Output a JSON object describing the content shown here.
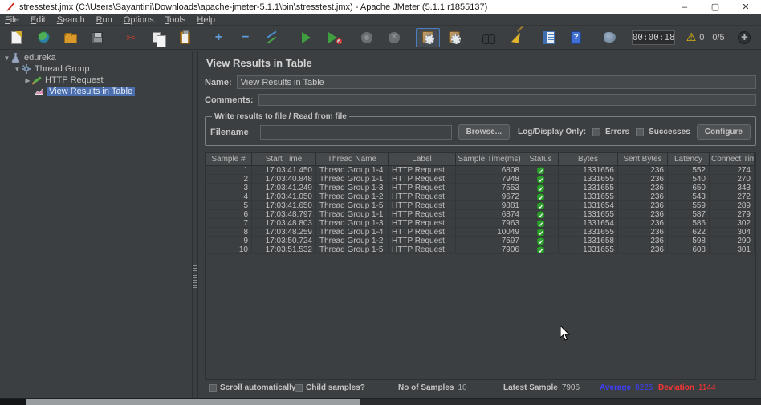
{
  "colors": {
    "selection": "#4b6eaf",
    "average": "#3f3fff",
    "deviation": "#ff3434",
    "status_ok": "#2f9e2f"
  },
  "window": {
    "title": "stresstest.jmx (C:\\Users\\Sayantini\\Downloads\\apache-jmeter-5.1.1\\bin\\stresstest.jmx) - Apache JMeter (5.1.1 r1855137)",
    "minimize": "–",
    "maximize": "▢",
    "close": "✕"
  },
  "menu": {
    "items": [
      "File",
      "Edit",
      "Search",
      "Run",
      "Options",
      "Tools",
      "Help"
    ]
  },
  "toolbar": {
    "timer": "00:00:18",
    "warning_count": "0",
    "thread_counter": "0/5",
    "help_glyph": "?",
    "plus": "+",
    "minus": "−",
    "cut_glyph": "✂",
    "x_glyph": "✕"
  },
  "tree": {
    "items": [
      {
        "label": "edureka",
        "expanded": true
      },
      {
        "label": "Thread Group",
        "expanded": true
      },
      {
        "label": "HTTP Request",
        "expanded": false
      },
      {
        "label": "View Results in Table",
        "selected": true
      }
    ]
  },
  "main": {
    "title": "View Results in Table",
    "name_label": "Name:",
    "name_value": "View Results in Table",
    "comments_label": "Comments:",
    "comments_value": "",
    "file_group": {
      "title": "Write results to file / Read from file",
      "filename_label": "Filename",
      "filename_value": "",
      "browse_label": "Browse...",
      "log_display_label": "Log/Display Only:",
      "errors_label": "Errors",
      "successes_label": "Successes",
      "configure_label": "Configure"
    }
  },
  "table": {
    "columns": [
      "Sample #",
      "Start Time",
      "Thread Name",
      "Label",
      "Sample Time(ms)",
      "Status",
      "Bytes",
      "Sent Bytes",
      "Latency",
      "Connect Time(..."
    ],
    "rows": [
      [
        "1",
        "17:03:41.450",
        "Thread Group 1-4",
        "HTTP Request",
        "6808",
        "success",
        "1331656",
        "236",
        "552",
        "274"
      ],
      [
        "2",
        "17:03:40.848",
        "Thread Group 1-1",
        "HTTP Request",
        "7948",
        "success",
        "1331655",
        "236",
        "540",
        "270"
      ],
      [
        "3",
        "17:03:41.249",
        "Thread Group 1-3",
        "HTTP Request",
        "7553",
        "success",
        "1331655",
        "236",
        "650",
        "343"
      ],
      [
        "4",
        "17:03:41.050",
        "Thread Group 1-2",
        "HTTP Request",
        "9672",
        "success",
        "1331655",
        "236",
        "543",
        "272"
      ],
      [
        "5",
        "17:03:41.650",
        "Thread Group 1-5",
        "HTTP Request",
        "9881",
        "success",
        "1331654",
        "236",
        "559",
        "289"
      ],
      [
        "6",
        "17:03:48.797",
        "Thread Group 1-1",
        "HTTP Request",
        "6874",
        "success",
        "1331655",
        "236",
        "587",
        "279"
      ],
      [
        "7",
        "17:03:48.803",
        "Thread Group 1-3",
        "HTTP Request",
        "7963",
        "success",
        "1331654",
        "236",
        "586",
        "302"
      ],
      [
        "8",
        "17:03:48.259",
        "Thread Group 1-4",
        "HTTP Request",
        "10049",
        "success",
        "1331655",
        "236",
        "622",
        "304"
      ],
      [
        "9",
        "17:03:50.724",
        "Thread Group 1-2",
        "HTTP Request",
        "7597",
        "success",
        "1331658",
        "236",
        "598",
        "290"
      ],
      [
        "10",
        "17:03:51.532",
        "Thread Group 1-5",
        "HTTP Request",
        "7906",
        "success",
        "1331655",
        "236",
        "608",
        "301"
      ]
    ]
  },
  "status_bar": {
    "scroll_label": "Scroll automatically?",
    "child_label": "Child samples?",
    "samples_label": "No of Samples",
    "samples_value": "10",
    "latest_label": "Latest Sample",
    "latest_value": "7906",
    "average_label": "Average",
    "average_value": "8225",
    "deviation_label": "Deviation",
    "deviation_value": "1144"
  }
}
